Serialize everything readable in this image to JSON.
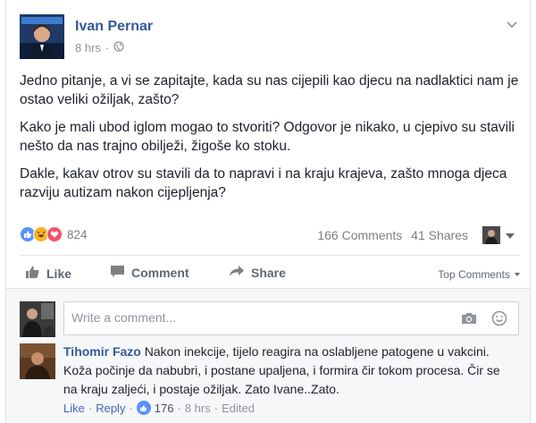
{
  "post": {
    "author": "Ivan Pernar",
    "time": "8 hrs",
    "time_sep": "·",
    "paragraphs": [
      "Jedno pitanje, a vi se zapitajte, kada su nas cijepili kao djecu na nadlaktici nam je ostao veliki ožiljak, zašto?",
      "Kako je mali ubod iglom mogao to stvoriti? Odgovor je nikako, u cjepivo su stavili nešto da nas trajno obilježi, žigoše ko stoku.",
      "Dakle, kakav otrov su stavili da to napravi i na kraju krajeva, zašto mnoga djeca razviju autizam nakon cijepljenja?"
    ]
  },
  "stats": {
    "reactions_count": "824",
    "comments": "166 Comments",
    "shares": "41 Shares"
  },
  "actions": {
    "like": "Like",
    "comment": "Comment",
    "share": "Share",
    "sort": "Top Comments"
  },
  "composer": {
    "placeholder": "Write a comment..."
  },
  "comment": {
    "author": "Tihomir Fazo",
    "text": "Nakon inekcije, tijelo reagira na oslabljene patogene u vakcini. Koža počinje da nabubri, i postane upaljena, i formira čir tokom procesa. Čir se na kraju zaljeći, i postaje ožiljak. Zato Ivane..Zato.",
    "like": "Like",
    "reply": "Reply",
    "sep": "·",
    "likes": "176",
    "time": "8 hrs",
    "edited": "Edited"
  },
  "colors": {
    "link_blue": "#365899",
    "like_blue": "#5890ff",
    "haha_yellow": "#f7b125",
    "love_red": "#f25268",
    "muted": "#90949c"
  },
  "icons": [
    "chevron-down-icon",
    "globe-icon",
    "like-reaction-icon",
    "haha-reaction-icon",
    "love-reaction-icon",
    "thumbs-up-icon",
    "comment-icon",
    "share-arrow-icon",
    "camera-icon",
    "smiley-icon"
  ]
}
